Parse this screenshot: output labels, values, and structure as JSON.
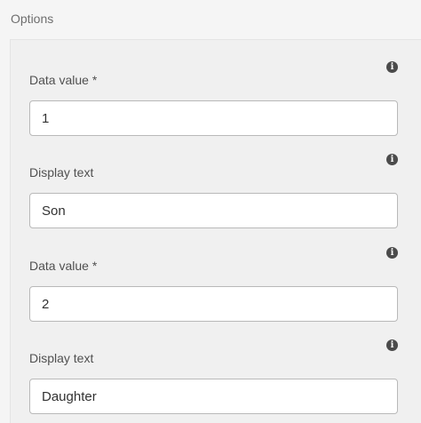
{
  "section": {
    "title": "Options"
  },
  "fields": [
    {
      "label": "Data value *",
      "value": "1",
      "icon": "info-icon"
    },
    {
      "label": "Display text",
      "value": "Son",
      "icon": "info-icon"
    },
    {
      "label": "Data value *",
      "value": "2",
      "icon": "info-icon"
    },
    {
      "label": "Display text",
      "value": "Daughter",
      "icon": "info-icon"
    }
  ],
  "colors": {
    "background": "#f5f5f5",
    "panel": "#f0f0f0",
    "input_border": "#b9b9b9",
    "icon": "#4b4b4b"
  }
}
